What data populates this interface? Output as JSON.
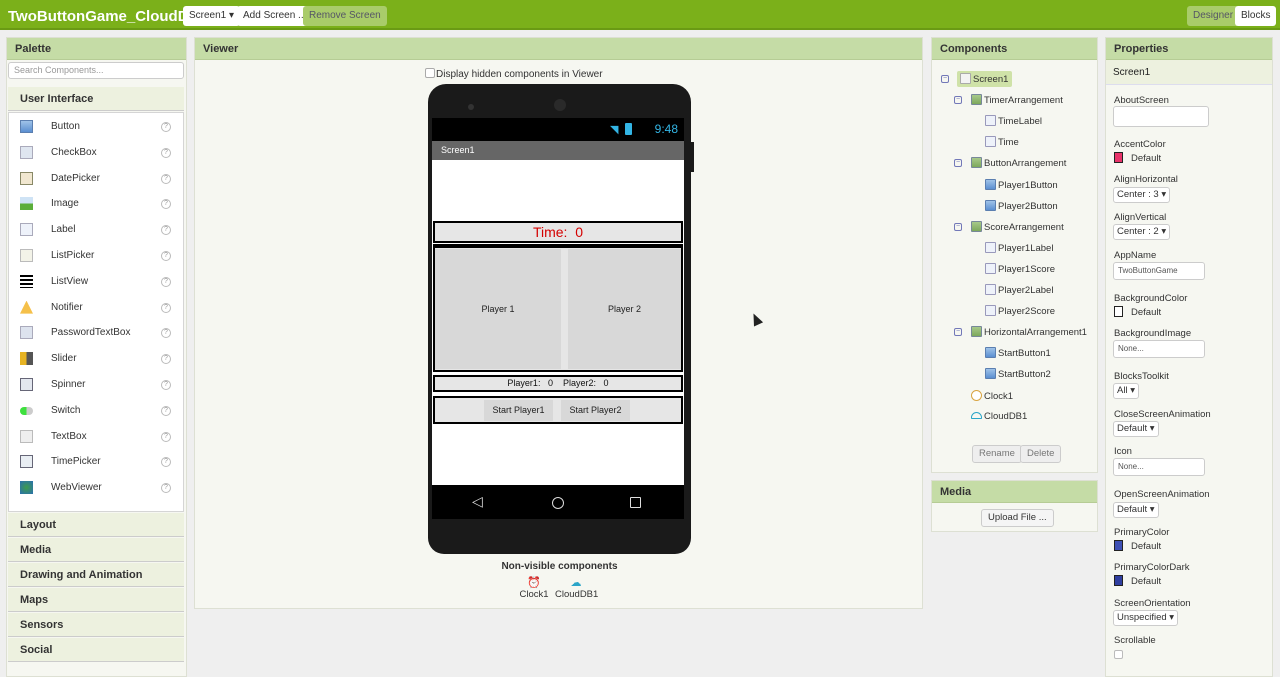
{
  "header": {
    "app_title": "TwoButtonGame_CloudDB",
    "screen_select": "Screen1 ▾",
    "add_screen": "Add Screen ...",
    "remove_screen": "Remove Screen",
    "designer": "Designer",
    "blocks": "Blocks"
  },
  "palette": {
    "title": "Palette",
    "search_placeholder": "Search Components...",
    "open_category": "User Interface",
    "items": [
      {
        "label": "Button",
        "icon": "button-icon"
      },
      {
        "label": "CheckBox",
        "icon": "checkbox-icon"
      },
      {
        "label": "DatePicker",
        "icon": "datepicker-icon"
      },
      {
        "label": "Image",
        "icon": "image-icon"
      },
      {
        "label": "Label",
        "icon": "label-icon"
      },
      {
        "label": "ListPicker",
        "icon": "listpicker-icon"
      },
      {
        "label": "ListView",
        "icon": "listview-icon"
      },
      {
        "label": "Notifier",
        "icon": "notifier-icon"
      },
      {
        "label": "PasswordTextBox",
        "icon": "password-icon"
      },
      {
        "label": "Slider",
        "icon": "slider-icon"
      },
      {
        "label": "Spinner",
        "icon": "spinner-icon"
      },
      {
        "label": "Switch",
        "icon": "switch-icon"
      },
      {
        "label": "TextBox",
        "icon": "textbox-icon"
      },
      {
        "label": "TimePicker",
        "icon": "timepicker-icon"
      },
      {
        "label": "WebViewer",
        "icon": "webviewer-icon"
      }
    ],
    "help_glyph": "?",
    "categories": [
      "Layout",
      "Media",
      "Drawing and Animation",
      "Maps",
      "Sensors",
      "Social"
    ]
  },
  "viewer": {
    "title": "Viewer",
    "hidden_checkbox_label": "Display hidden components in Viewer",
    "status_time": "9:48",
    "screen_title": "Screen1",
    "time_label": "Time:",
    "time_value": "0",
    "player1_button": "Player 1",
    "player2_button": "Player 2",
    "player1_label": "Player1:",
    "player1_score": "0",
    "player2_label": "Player2:",
    "player2_score": "0",
    "start1": "Start Player1",
    "start2": "Start Player2",
    "nonvisible_title": "Non-visible components",
    "nonvisible": [
      "Clock1",
      "CloudDB1"
    ]
  },
  "components": {
    "title": "Components",
    "tree": [
      {
        "label": "Screen1",
        "type": "screen",
        "level": 0,
        "selected": true
      },
      {
        "label": "TimerArrangement",
        "type": "arrangement",
        "level": 1
      },
      {
        "label": "TimeLabel",
        "type": "label",
        "level": 2
      },
      {
        "label": "Time",
        "type": "label",
        "level": 2
      },
      {
        "label": "ButtonArrangement",
        "type": "arrangement",
        "level": 1
      },
      {
        "label": "Player1Button",
        "type": "button",
        "level": 2
      },
      {
        "label": "Player2Button",
        "type": "button",
        "level": 2
      },
      {
        "label": "ScoreArrangement",
        "type": "arrangement",
        "level": 1
      },
      {
        "label": "Player1Label",
        "type": "label",
        "level": 2
      },
      {
        "label": "Player1Score",
        "type": "label",
        "level": 2
      },
      {
        "label": "Player2Label",
        "type": "label",
        "level": 2
      },
      {
        "label": "Player2Score",
        "type": "label",
        "level": 2
      },
      {
        "label": "HorizontalArrangement1",
        "type": "arrangement",
        "level": 1
      },
      {
        "label": "StartButton1",
        "type": "button",
        "level": 2
      },
      {
        "label": "StartButton2",
        "type": "button",
        "level": 2
      },
      {
        "label": "Clock1",
        "type": "clock",
        "level": 1
      },
      {
        "label": "CloudDB1",
        "type": "cloud",
        "level": 1
      }
    ],
    "rename": "Rename",
    "delete": "Delete"
  },
  "media": {
    "title": "Media",
    "upload": "Upload File ..."
  },
  "properties": {
    "title": "Properties",
    "component": "Screen1",
    "about_screen": {
      "label": "AboutScreen",
      "value": ""
    },
    "accent_color": {
      "label": "AccentColor",
      "value": "Default",
      "color": "#e8336a"
    },
    "align_horizontal": {
      "label": "AlignHorizontal",
      "value": "Center : 3 ▾"
    },
    "align_vertical": {
      "label": "AlignVertical",
      "value": "Center : 2 ▾"
    },
    "app_name": {
      "label": "AppName",
      "value": "TwoButtonGame"
    },
    "background_color": {
      "label": "BackgroundColor",
      "value": "Default",
      "color": "#ffffff"
    },
    "background_image": {
      "label": "BackgroundImage",
      "value": "None..."
    },
    "blocks_toolkit": {
      "label": "BlocksToolkit",
      "value": "All ▾"
    },
    "close_anim": {
      "label": "CloseScreenAnimation",
      "value": "Default ▾"
    },
    "icon": {
      "label": "Icon",
      "value": "None..."
    },
    "open_anim": {
      "label": "OpenScreenAnimation",
      "value": "Default ▾"
    },
    "primary_color": {
      "label": "PrimaryColor",
      "value": "Default",
      "color": "#3f51b5"
    },
    "primary_color_dark": {
      "label": "PrimaryColorDark",
      "value": "Default",
      "color": "#303f9f"
    },
    "orientation": {
      "label": "ScreenOrientation",
      "value": "Unspecified ▾"
    },
    "scrollable": {
      "label": "Scrollable",
      "checked": false
    }
  }
}
